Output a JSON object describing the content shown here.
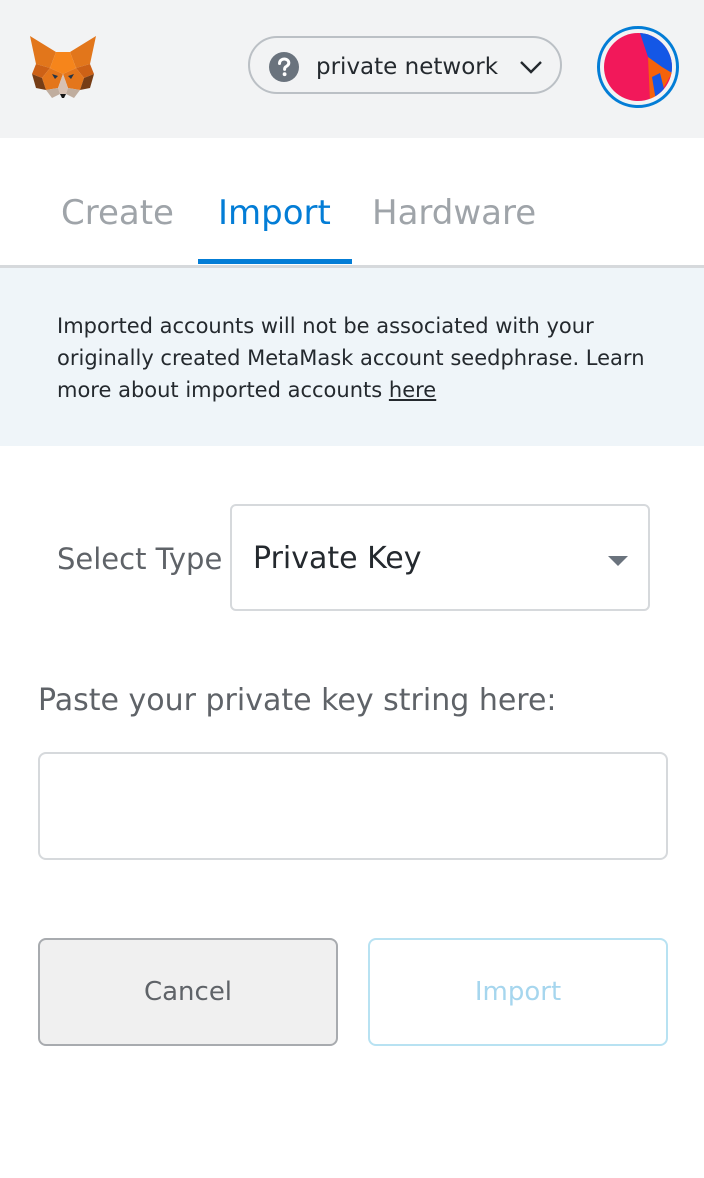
{
  "header": {
    "logo_icon": "metamask-fox-icon",
    "network": {
      "label": "private network",
      "icon": "question-circle-icon",
      "dropdown_icon": "chevron-down-icon"
    },
    "account_avatar": "account-identicon"
  },
  "tabs": [
    {
      "label": "Create",
      "active": false
    },
    {
      "label": "Import",
      "active": true
    },
    {
      "label": "Hardware",
      "active": false
    }
  ],
  "notice": {
    "text": "Imported accounts will not be associated with your originally created MetaMask account seedphrase. Learn more about imported accounts ",
    "link": "here"
  },
  "import_form": {
    "select_label": "Select Type",
    "select_value": "Private Key",
    "key_label": "Paste your private key string here:",
    "key_value": "",
    "cancel_label": "Cancel",
    "import_label": "Import"
  },
  "colors": {
    "accent": "#037dd6",
    "header_bg": "#f2f3f4",
    "notice_bg": "#eff5f9",
    "inactive_tab": "#9fa4a9",
    "disabled_button_text": "#a6d6ee"
  }
}
